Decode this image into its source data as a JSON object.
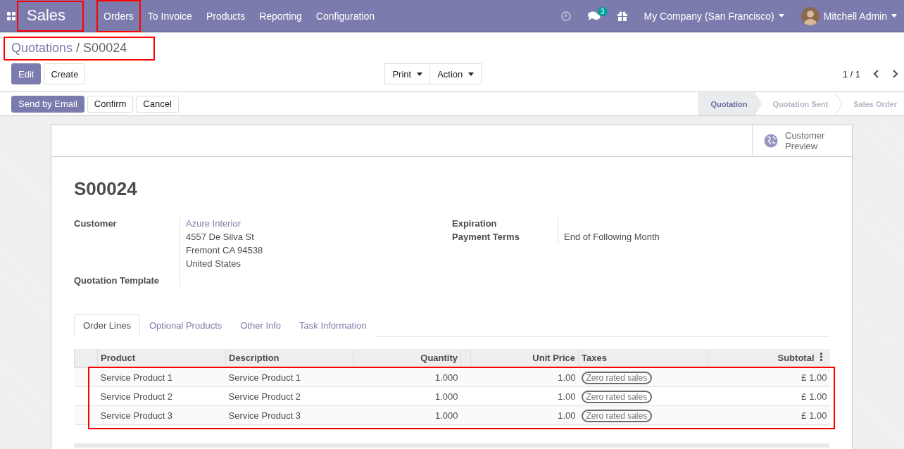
{
  "navbar": {
    "app": {
      "label": "Sales",
      "highlighted": true
    },
    "menu": [
      {
        "label": "Orders",
        "highlighted": true
      },
      {
        "label": "To Invoice",
        "highlighted": false
      },
      {
        "label": "Products",
        "highlighted": false
      },
      {
        "label": "Reporting",
        "highlighted": false
      },
      {
        "label": "Configuration",
        "highlighted": false
      }
    ],
    "messages_badge": "3",
    "company": "My Company (San Francisco)",
    "user": "Mitchell Admin"
  },
  "breadcrumb": {
    "parent": "Quotations",
    "separator": "/",
    "current": "S00024",
    "highlighted": true
  },
  "buttons": {
    "edit": "Edit",
    "create": "Create",
    "print": "Print",
    "action": "Action"
  },
  "pager": "1 / 1",
  "status_buttons": [
    {
      "label": "Send by Email",
      "primary": true
    },
    {
      "label": "Confirm",
      "primary": false
    },
    {
      "label": "Cancel",
      "primary": false
    }
  ],
  "stages": [
    {
      "label": "Quotation",
      "selected": true
    },
    {
      "label": "Quotation Sent",
      "selected": false
    },
    {
      "label": "Sales Order",
      "selected": false
    }
  ],
  "smart_button": "Customer Preview",
  "title": "S00024",
  "left_fields": [
    {
      "label": "Customer",
      "link": "Azure Interior",
      "lines": [
        "4557 De Silva St",
        "Fremont CA 94538",
        "United States"
      ]
    },
    {
      "label": "Quotation Template"
    }
  ],
  "right_fields": [
    {
      "label": "Expiration"
    },
    {
      "label": "Payment Terms",
      "value": "End of Following Month"
    }
  ],
  "tabs": [
    {
      "label": "Order Lines",
      "selected": true
    },
    {
      "label": "Optional Products",
      "selected": false
    },
    {
      "label": "Other Info",
      "selected": false
    },
    {
      "label": "Task Information",
      "selected": false
    }
  ],
  "table": {
    "columns": [
      "Product",
      "Description",
      "Quantity",
      "Unit Price",
      "Taxes",
      "Subtotal"
    ],
    "rows_highlighted": true,
    "rows": [
      {
        "product": "Service Product 1",
        "description": "Service Product 1",
        "quantity": "1.000",
        "unit_price": "1.00",
        "tax": "Zero rated sales",
        "subtotal": "£ 1.00"
      },
      {
        "product": "Service Product 2",
        "description": "Service Product 2",
        "quantity": "1.000",
        "unit_price": "1.00",
        "tax": "Zero rated sales",
        "subtotal": "£ 1.00"
      },
      {
        "product": "Service Product 3",
        "description": "Service Product 3",
        "quantity": "1.000",
        "unit_price": "1.00",
        "tax": "Zero rated sales",
        "subtotal": "£ 1.00"
      }
    ]
  }
}
